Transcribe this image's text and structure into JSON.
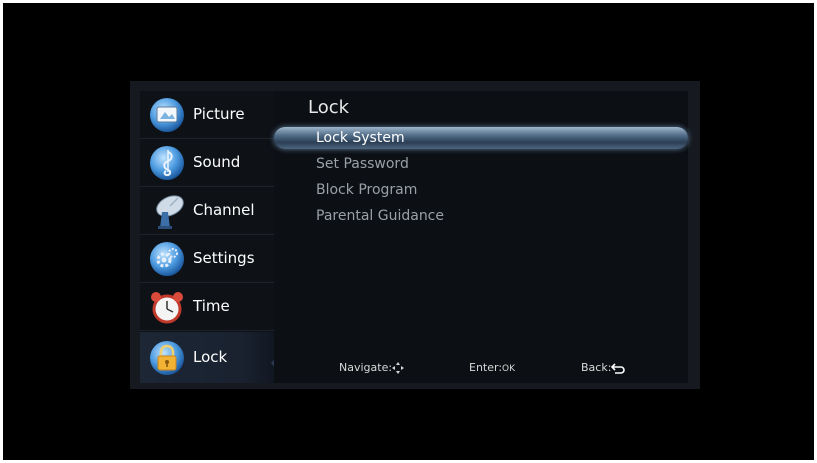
{
  "sidebar": {
    "items": [
      {
        "label": "Picture",
        "icon": "picture-icon"
      },
      {
        "label": "Sound",
        "icon": "music-note-icon"
      },
      {
        "label": "Channel",
        "icon": "satellite-dish-icon"
      },
      {
        "label": "Settings",
        "icon": "gear-icon"
      },
      {
        "label": "Time",
        "icon": "alarm-clock-icon"
      },
      {
        "label": "Lock",
        "icon": "padlock-icon"
      }
    ],
    "selected": "Lock"
  },
  "panel": {
    "title": "Lock",
    "items": [
      "Lock System",
      "Set Password",
      "Block Program",
      "Parental Guidance"
    ],
    "selected": "Lock System"
  },
  "footer": {
    "navigate_label": "Navigate:",
    "enter_label": "Enter:",
    "enter_key": "OK",
    "back_label": "Back:"
  },
  "colors": {
    "background": "#000000",
    "osd_panel": "#161a20",
    "highlight": "#4f6a85",
    "text_active": "#ffffff",
    "text_inactive": "#9aa0a8"
  }
}
